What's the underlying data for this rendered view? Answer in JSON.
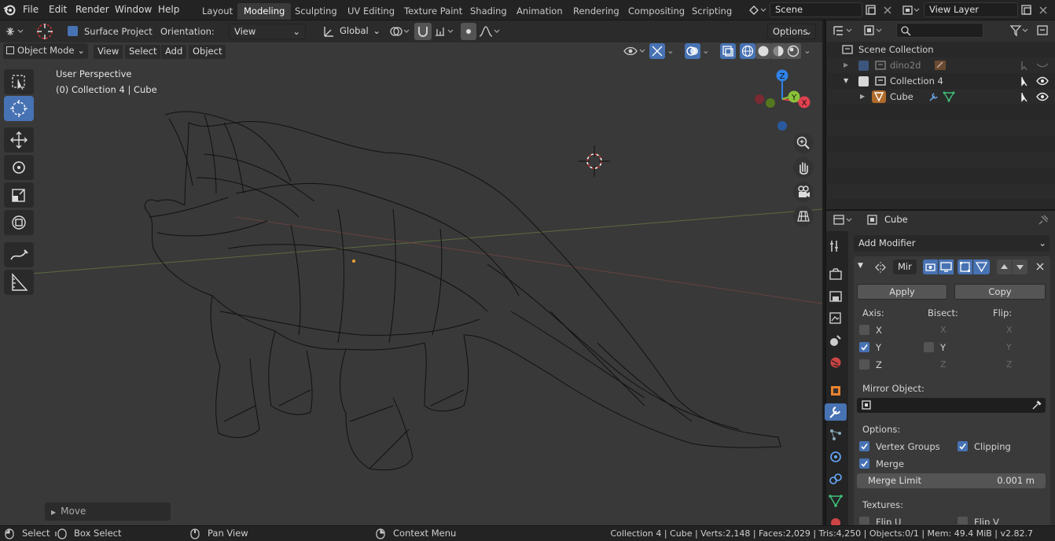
{
  "menu": [
    "File",
    "Edit",
    "Render",
    "Window",
    "Help"
  ],
  "workspaces": [
    "Layout",
    "Modeling",
    "Sculpting",
    "UV Editing",
    "Texture Paint",
    "Shading",
    "Animation",
    "Rendering",
    "Compositing",
    "Scripting"
  ],
  "scene_name": "Scene",
  "view_layer": "View Layer",
  "tool_header": {
    "surface_project": "Surface Project",
    "orientation_label": "Orientation:",
    "orientation_value": "View",
    "transform_orientation": "Global",
    "options": "Options"
  },
  "viewport_header": {
    "mode": "Object Mode",
    "view": "View",
    "select": "Select",
    "add": "Add",
    "object": "Object"
  },
  "viewport": {
    "perspective": "User Perspective",
    "collection_info": "(0) Collection 4 | Cube",
    "operator_panel": "Move",
    "gizmo_axes": {
      "z": "Z",
      "y": "Y",
      "x": "X"
    }
  },
  "outliner": {
    "scene_collection": "Scene Collection",
    "items": [
      {
        "name": "dino2d",
        "expanded": false
      },
      {
        "name": "Collection 4",
        "expanded": true
      },
      {
        "name": "Cube"
      }
    ]
  },
  "properties": {
    "object_name": "Cube",
    "add_modifier": "Add Modifier",
    "modifier_name": "Mir",
    "apply": "Apply",
    "copy": "Copy",
    "axis_label": "Axis:",
    "bisect_label": "Bisect:",
    "flip_label": "Flip:",
    "axes": [
      "X",
      "Y",
      "Z"
    ],
    "axis_checked": [
      false,
      true,
      false
    ],
    "mirror_object_label": "Mirror Object:",
    "options_label": "Options:",
    "vertex_groups": "Vertex Groups",
    "clipping": "Clipping",
    "merge": "Merge",
    "merge_limit_label": "Merge Limit",
    "merge_limit_value": "0.001 m",
    "textures_label": "Textures:",
    "flip_u": "Flip U",
    "flip_v": "Flip V"
  },
  "status_bar": {
    "select": "Select",
    "box_select": "Box Select",
    "pan_view": "Pan View",
    "context_menu": "Context Menu",
    "stats": "Collection 4 | Cube | Verts:2,148 | Faces:2,029 | Tris:4,250 | Objects:0/1 | Mem: 49.4 MiB | v2.82.7"
  },
  "colors": {
    "accent": "#4772b3",
    "viewport_bg": "#393939",
    "x_axis": "#e0414f",
    "y_axis": "#8ac23a",
    "z_axis": "#2f82e8"
  }
}
